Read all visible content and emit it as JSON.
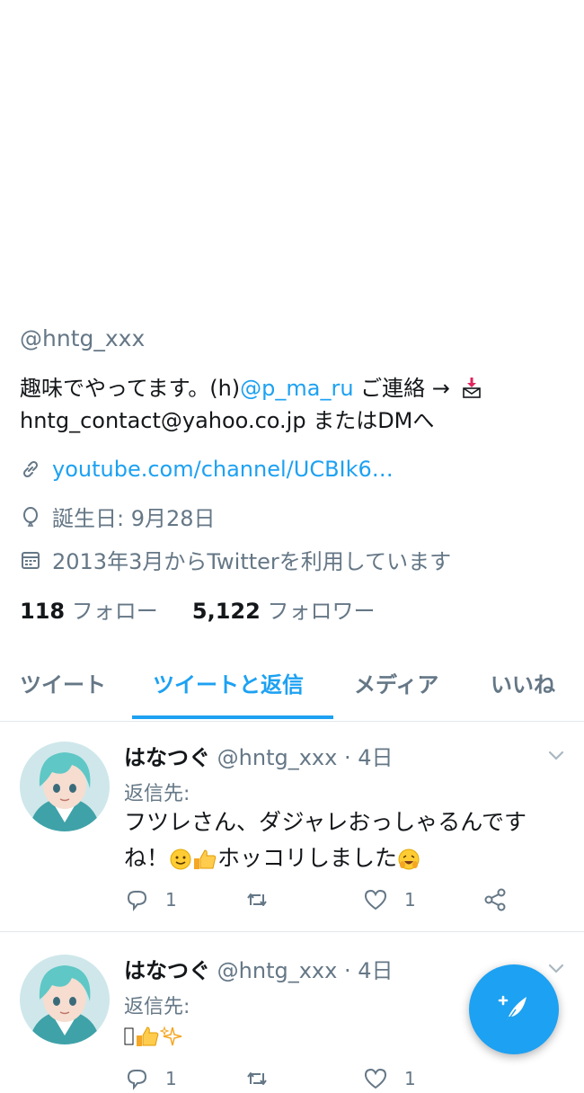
{
  "profile": {
    "handle": "@hntg_xxx",
    "bio": {
      "part1": "趣味でやってます。(h)",
      "mention": "@p_ma_ru",
      "part2": " ご連絡 → ",
      "line2": "hntg_contact@yahoo.co.jp またはDMへ"
    },
    "website": "youtube.com/channel/UCBIk6…",
    "birthday": "誕生日: 9月28日",
    "joined": "2013年3月からTwitterを利用しています",
    "following_count": "118",
    "following_label": "フォロー",
    "followers_count": "5,122",
    "followers_label": "フォロワー"
  },
  "tabs": [
    {
      "label": "ツイート",
      "active": false
    },
    {
      "label": "ツイートと返信",
      "active": true
    },
    {
      "label": "メディア",
      "active": false
    },
    {
      "label": "いいね",
      "active": false
    }
  ],
  "tweets": [
    {
      "name": "はなつぐ",
      "handle_time": "@hntg_xxx · 4日",
      "reply_to": "返信先:",
      "text_line1": "フツレさん、ダジャレおっしゃるんです",
      "text_line2a": "ね！",
      "text_line2b": "ホッコリしました",
      "reply_count": "1",
      "like_count": "1"
    },
    {
      "name": "はなつぐ",
      "handle_time": "@hntg_xxx · 4日",
      "reply_to": "返信先:",
      "text_glyph": "🙏",
      "reply_count": "1",
      "like_count": "1"
    }
  ],
  "colors": {
    "accent": "#1da1f2",
    "muted": "#657786",
    "text": "#14171a",
    "border": "#e1e8ed"
  },
  "icons": [
    "link-icon",
    "balloon-icon",
    "calendar-icon",
    "reply-icon",
    "retweet-icon",
    "heart-icon",
    "share-icon",
    "chevron-down-icon",
    "compose-icon",
    "mail-download-icon"
  ]
}
